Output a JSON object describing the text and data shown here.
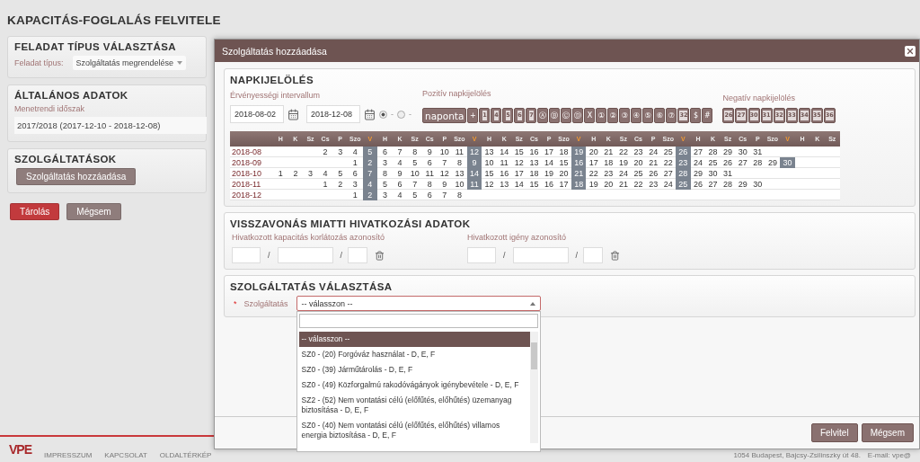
{
  "page": {
    "title": "KAPACITÁS-FOGLALÁS FELVITELE",
    "task_type": {
      "heading": "FELADAT TÍPUS VÁLASZTÁSA",
      "label": "Feladat típus:",
      "value": "Szolgáltatás megrendelése"
    },
    "general": {
      "heading": "ÁLTALÁNOS ADATOK",
      "label": "Menetrendi időszak",
      "value": "2017/2018 (2017-12-10 - 2018-12-08)"
    },
    "services": {
      "heading": "SZOLGÁLTATÁSOK",
      "button": "Szolgáltatás hozzáadása"
    },
    "buttons": [
      {
        "label": "Tárolás",
        "kind": "primary"
      },
      {
        "label": "Mégsem",
        "kind": "secondary"
      }
    ],
    "footer": {
      "logo": "VPE",
      "links": [
        "IMPRESSZUM",
        "KAPCSOLAT",
        "OLDALTÉRKÉP"
      ],
      "address": "1054 Budapest, Bajcsy-Zsilinszky út 48.",
      "email": "E-mail: vpe@"
    }
  },
  "modal": {
    "title": "Szolgáltatás hozzáadása",
    "day_marking": {
      "heading": "NAPKIJELÖLÉS",
      "validity_label": "Érvényességi intervallum",
      "date_from": "2018-08-02",
      "date_to": "2018-12-08",
      "radios": [
        {
          "selected": true,
          "suffix": "-"
        },
        {
          "selected": false,
          "suffix": "-"
        }
      ],
      "positive_label": "Pozitív napkijelölés",
      "positive_marks": [
        {
          "label": "naponta",
          "kind": "wide"
        },
        {
          "label": "+",
          "kind": "plain"
        },
        {
          "label": "1",
          "kind": "boxed"
        },
        {
          "label": "4",
          "kind": "boxed"
        },
        {
          "label": "5",
          "kind": "boxed"
        },
        {
          "label": "6",
          "kind": "boxed"
        },
        {
          "label": "7",
          "kind": "boxed"
        },
        {
          "label": "Ⓐ",
          "kind": "plain"
        },
        {
          "label": "Ⓑ",
          "kind": "plain"
        },
        {
          "label": "Ⓒ",
          "kind": "plain"
        },
        {
          "label": "Ⓓ",
          "kind": "plain"
        },
        {
          "label": "X",
          "kind": "plain"
        },
        {
          "label": "①",
          "kind": "plain"
        },
        {
          "label": "②",
          "kind": "plain"
        },
        {
          "label": "③",
          "kind": "plain"
        },
        {
          "label": "④",
          "kind": "plain"
        },
        {
          "label": "⑤",
          "kind": "plain"
        },
        {
          "label": "⑥",
          "kind": "plain"
        },
        {
          "label": "⑦",
          "kind": "plain"
        },
        {
          "label": "32",
          "kind": "boxed"
        },
        {
          "label": "$",
          "kind": "plain"
        },
        {
          "label": "#",
          "kind": "plain"
        }
      ],
      "negative_label": "Negatív napkijelölés",
      "negative_marks": [
        {
          "label": "26",
          "kind": "boxed"
        },
        {
          "label": "27",
          "kind": "boxed"
        },
        {
          "label": "30",
          "kind": "boxed"
        },
        {
          "label": "31",
          "kind": "boxed"
        },
        {
          "label": "32",
          "kind": "boxed"
        },
        {
          "label": "33",
          "kind": "boxed"
        },
        {
          "label": "34",
          "kind": "boxed"
        },
        {
          "label": "35",
          "kind": "boxed"
        },
        {
          "label": "36",
          "kind": "boxed"
        }
      ],
      "calendar": {
        "headers": [
          {
            "label": "H",
            "kind": "weekday"
          },
          {
            "label": "K",
            "kind": "weekday"
          },
          {
            "label": "Sz",
            "kind": "weekday"
          },
          {
            "label": "Cs",
            "kind": "weekday"
          },
          {
            "label": "P",
            "kind": "weekday"
          },
          {
            "label": "Szo",
            "kind": "weekday"
          },
          {
            "label": "V",
            "kind": "sunday"
          },
          {
            "label": "H",
            "kind": "weekday"
          },
          {
            "label": "K",
            "kind": "weekday"
          },
          {
            "label": "Sz",
            "kind": "weekday"
          },
          {
            "label": "Cs",
            "kind": "weekday"
          },
          {
            "label": "P",
            "kind": "weekday"
          },
          {
            "label": "Szo",
            "kind": "weekday"
          },
          {
            "label": "V",
            "kind": "sunday"
          },
          {
            "label": "H",
            "kind": "weekday"
          },
          {
            "label": "K",
            "kind": "weekday"
          },
          {
            "label": "Sz",
            "kind": "weekday"
          },
          {
            "label": "Cs",
            "kind": "weekday"
          },
          {
            "label": "P",
            "kind": "weekday"
          },
          {
            "label": "Szo",
            "kind": "weekday"
          },
          {
            "label": "V",
            "kind": "sunday"
          },
          {
            "label": "H",
            "kind": "weekday"
          },
          {
            "label": "K",
            "kind": "weekday"
          },
          {
            "label": "Sz",
            "kind": "weekday"
          },
          {
            "label": "Cs",
            "kind": "weekday"
          },
          {
            "label": "P",
            "kind": "weekday"
          },
          {
            "label": "Szo",
            "kind": "weekday"
          },
          {
            "label": "V",
            "kind": "sunday"
          },
          {
            "label": "H",
            "kind": "weekday"
          },
          {
            "label": "K",
            "kind": "weekday"
          },
          {
            "label": "Sz",
            "kind": "weekday"
          },
          {
            "label": "Cs",
            "kind": "weekday"
          },
          {
            "label": "P",
            "kind": "weekday"
          },
          {
            "label": "Szo",
            "kind": "weekday"
          },
          {
            "label": "V",
            "kind": "sunday"
          },
          {
            "label": "H",
            "kind": "weekday"
          },
          {
            "label": "K",
            "kind": "weekday"
          },
          {
            "label": "Sz",
            "kind": "weekday"
          }
        ],
        "rows": [
          {
            "month": "2018-08",
            "days": [
              {
                "kind": "blank"
              },
              {
                "kind": "blank"
              },
              {
                "kind": "blank"
              },
              "2",
              "3",
              "4",
              "5",
              "6",
              "7",
              "8",
              "9",
              "10",
              "11",
              "12",
              "13",
              "14",
              "15",
              "16",
              "17",
              "18",
              "19",
              "20",
              "21",
              "22",
              "23",
              "24",
              "25",
              "26",
              "27",
              "28",
              "29",
              "30",
              "31"
            ]
          },
          {
            "month": "2018-09",
            "days": [
              {
                "kind": "blank"
              },
              {
                "kind": "blank"
              },
              {
                "kind": "blank"
              },
              {
                "kind": "blank"
              },
              {
                "kind": "blank"
              },
              "1",
              "2",
              "3",
              "4",
              "5",
              "6",
              "7",
              "8",
              "9",
              "10",
              "11",
              "12",
              "13",
              "14",
              "15",
              "16",
              "17",
              "18",
              "19",
              "20",
              "21",
              "22",
              "23",
              "24",
              "25",
              "26",
              "27",
              "28",
              "29",
              "30"
            ]
          },
          {
            "month": "2018-10",
            "days": [
              "1",
              "2",
              "3",
              "4",
              "5",
              "6",
              "7",
              "8",
              "9",
              "10",
              "11",
              "12",
              "13",
              "14",
              "15",
              "16",
              "17",
              "18",
              "19",
              "20",
              "21",
              "22",
              "23",
              "24",
              "25",
              "26",
              "27",
              "28",
              "29",
              "30",
              "31"
            ]
          },
          {
            "month": "2018-11",
            "days": [
              {
                "kind": "blank"
              },
              {
                "kind": "blank"
              },
              {
                "kind": "blank"
              },
              "1",
              "2",
              "3",
              "4",
              "5",
              "6",
              "7",
              "8",
              "9",
              "10",
              "11",
              "12",
              "13",
              "14",
              "15",
              "16",
              "17",
              "18",
              "19",
              "20",
              "21",
              "22",
              "23",
              "24",
              "25",
              "26",
              "27",
              "28",
              "29",
              "30"
            ]
          },
          {
            "month": "2018-12",
            "days": [
              {
                "kind": "blank"
              },
              {
                "kind": "blank"
              },
              {
                "kind": "blank"
              },
              {
                "kind": "blank"
              },
              {
                "kind": "blank"
              },
              "1",
              "2",
              "3",
              "4",
              "5",
              "6",
              "7",
              "8"
            ]
          }
        ]
      }
    },
    "reference": {
      "heading": "VISSZAVONÁS MIATTI HIVATKOZÁSI ADATOK",
      "groups": [
        {
          "label": "Hivatkozott kapacitás korlátozás azonosító",
          "separators": [
            "/",
            "/"
          ]
        },
        {
          "label": "Hivatkozott igény azonosító",
          "separators": [
            "/",
            "/"
          ]
        }
      ]
    },
    "service_select": {
      "heading": "SZOLGÁLTATÁS VÁLASZTÁSA",
      "label": "Szolgáltatás",
      "required_mark": "*",
      "value": "-- válasszon --",
      "expanded": true,
      "options": [
        {
          "label": "-- válasszon --",
          "selected": true
        },
        {
          "label": "SZ0 - (20) Forgóváz használat - D, E, F",
          "selected": false
        },
        {
          "label": "SZ0 - (39) Járműtárolás - D, E, F",
          "selected": false
        },
        {
          "label": "SZ0 - (49) Közforgalmú rakodóvágányok igénybevétele - D, E, F",
          "selected": false
        },
        {
          "label": "SZ2 - (52) Nem vontatási célú (előfűtés, előhűtés) üzemanyag biztosítása - D, E, F",
          "selected": false
        },
        {
          "label": "SZ0 - (40) Nem vontatási célú (előfűtés, előhűtés) villamos energia biztosítása - D, E, F",
          "selected": false
        }
      ]
    },
    "buttons": [
      "Felvitel",
      "Mégsem"
    ]
  }
}
